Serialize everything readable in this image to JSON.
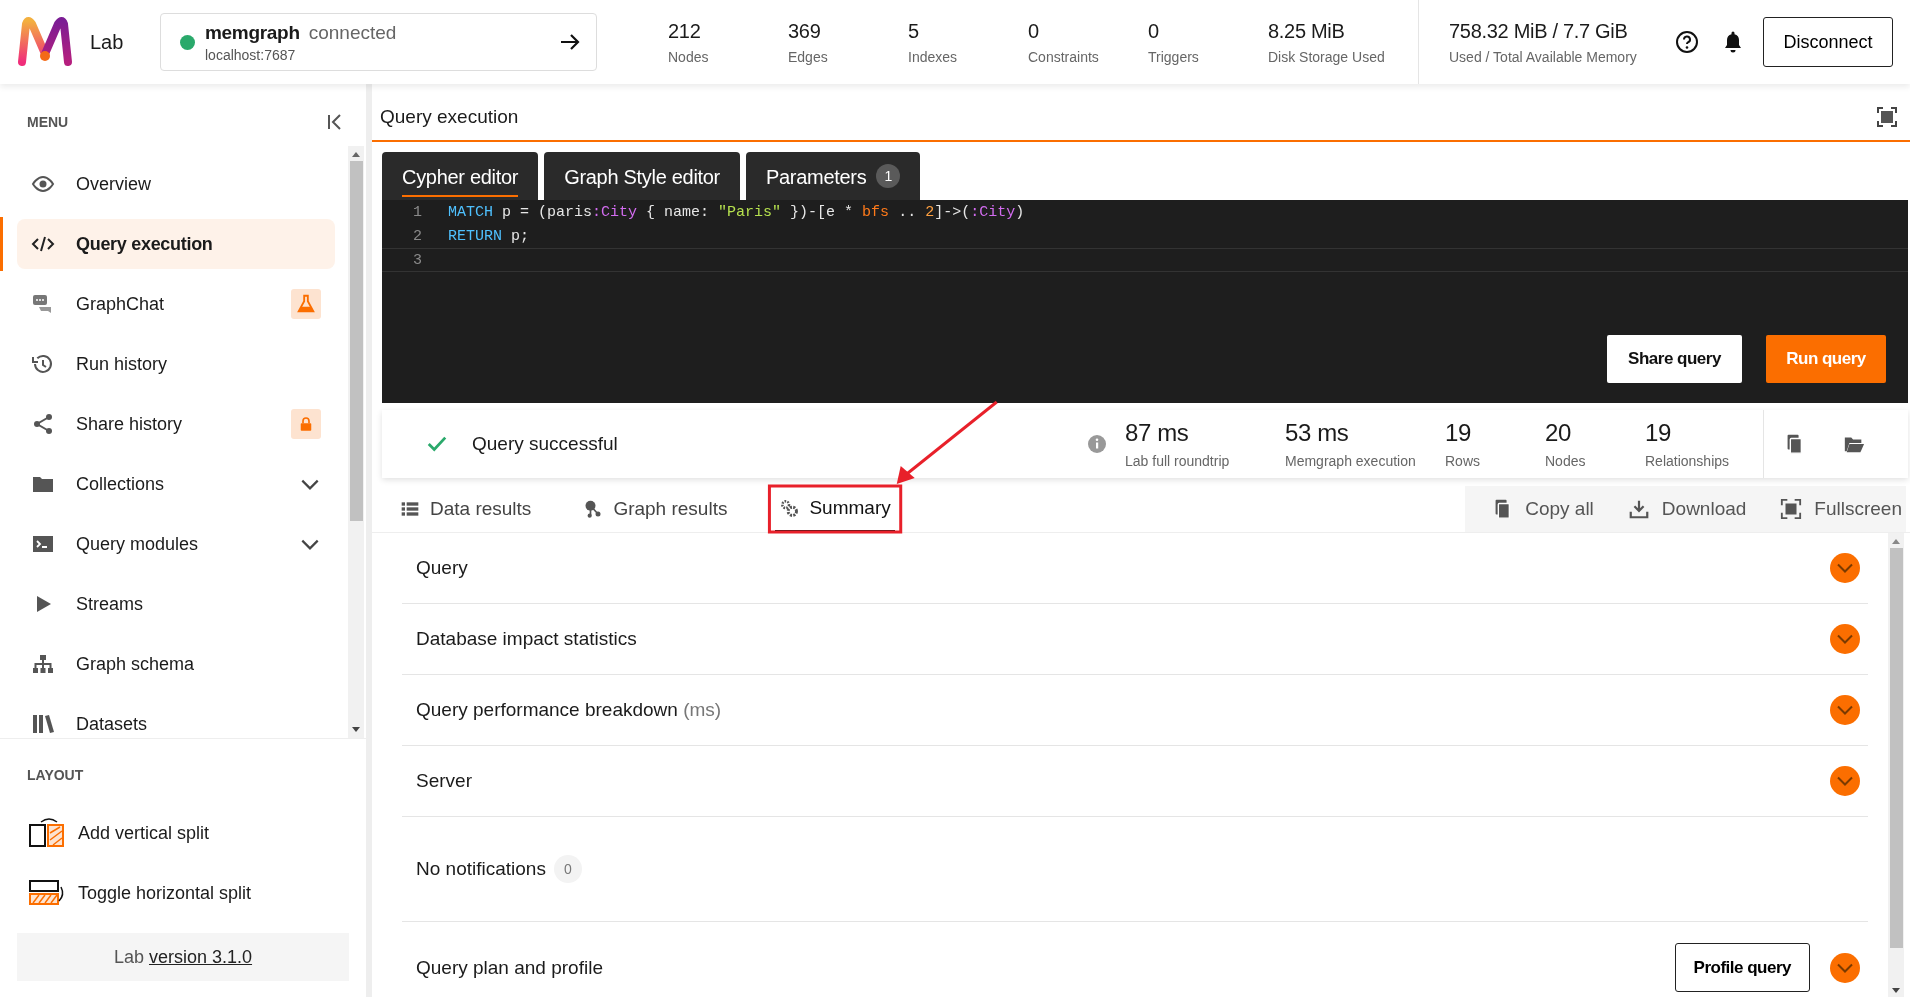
{
  "app": {
    "name": "Lab"
  },
  "connection": {
    "name": "memgraph",
    "status": "connected",
    "host": "localhost:7687",
    "online": true
  },
  "stats": [
    {
      "value": "212",
      "label": "Nodes"
    },
    {
      "value": "369",
      "label": "Edges"
    },
    {
      "value": "5",
      "label": "Indexes"
    },
    {
      "value": "0",
      "label": "Constraints"
    },
    {
      "value": "0",
      "label": "Triggers"
    },
    {
      "value": "8.25 MiB",
      "label": "Disk Storage Used"
    }
  ],
  "memory": {
    "value": "758.32 MiB / 7.7 GiB",
    "label": "Used / Total Available Memory"
  },
  "disconnect_button": "Disconnect",
  "sidebar": {
    "menu_heading": "MENU",
    "items": [
      {
        "label": "Overview",
        "selected": false,
        "experimental": false,
        "locked": false,
        "expandable": false
      },
      {
        "label": "Query execution",
        "selected": true,
        "experimental": false,
        "locked": false,
        "expandable": false
      },
      {
        "label": "GraphChat",
        "selected": false,
        "experimental": true,
        "locked": false,
        "expandable": false
      },
      {
        "label": "Run history",
        "selected": false,
        "experimental": false,
        "locked": false,
        "expandable": false
      },
      {
        "label": "Share history",
        "selected": false,
        "experimental": false,
        "locked": true,
        "expandable": false
      },
      {
        "label": "Collections",
        "selected": false,
        "experimental": false,
        "locked": false,
        "expandable": true
      },
      {
        "label": "Query modules",
        "selected": false,
        "experimental": false,
        "locked": false,
        "expandable": true
      },
      {
        "label": "Streams",
        "selected": false,
        "experimental": false,
        "locked": false,
        "expandable": false
      },
      {
        "label": "Graph schema",
        "selected": false,
        "experimental": false,
        "locked": false,
        "expandable": false
      },
      {
        "label": "Datasets",
        "selected": false,
        "experimental": false,
        "locked": false,
        "expandable": false
      }
    ],
    "layout_heading": "LAYOUT",
    "layout_items": [
      "Add vertical split",
      "Toggle horizontal split"
    ],
    "version": {
      "prefix": "Lab",
      "link": "version 3.1.0"
    }
  },
  "panel_title": "Query execution",
  "editor_tabs": [
    {
      "label": "Cypher editor",
      "selected": true
    },
    {
      "label": "Graph Style editor",
      "selected": false
    },
    {
      "label": "Parameters",
      "selected": false,
      "count": "1"
    }
  ],
  "code_lines": [
    {
      "number": "1",
      "tokens": [
        {
          "text": "MATCH",
          "kind": "keyword"
        },
        {
          "text": " p = (paris",
          "kind": "plain"
        },
        {
          "text": ":City",
          "kind": "label"
        },
        {
          "text": " { name: ",
          "kind": "plain"
        },
        {
          "text": "\"Paris\"",
          "kind": "string"
        },
        {
          "text": " })-[e * ",
          "kind": "plain"
        },
        {
          "text": "bfs",
          "kind": "function"
        },
        {
          "text": " .. ",
          "kind": "plain"
        },
        {
          "text": "2",
          "kind": "number"
        },
        {
          "text": "]->(",
          "kind": "plain"
        },
        {
          "text": ":City",
          "kind": "label"
        },
        {
          "text": ")",
          "kind": "plain"
        }
      ]
    },
    {
      "number": "2",
      "tokens": [
        {
          "text": "RETURN",
          "kind": "keyword"
        },
        {
          "text": " p;",
          "kind": "plain"
        }
      ]
    },
    {
      "number": "3"
    }
  ],
  "editor_buttons": {
    "share": "Share query",
    "run": "Run query"
  },
  "result_status": {
    "message": "Query successful",
    "success": true
  },
  "metrics": [
    {
      "value": "87 ms",
      "label": "Lab full roundtrip"
    },
    {
      "value": "53 ms",
      "label": "Memgraph execution"
    },
    {
      "value": "19",
      "label": "Rows"
    },
    {
      "value": "20",
      "label": "Nodes"
    },
    {
      "value": "19",
      "label": "Relationships"
    }
  ],
  "result_tabs": [
    {
      "label": "Data results",
      "selected": false
    },
    {
      "label": "Graph results",
      "selected": false
    },
    {
      "label": "Summary",
      "selected": true
    }
  ],
  "result_actions": [
    "Copy all",
    "Download",
    "Fullscreen"
  ],
  "summary_sections": [
    {
      "title": "Query",
      "expandable": true
    },
    {
      "title": "Database impact statistics",
      "expandable": true
    },
    {
      "title": "Query performance breakdown",
      "unit": "(ms)",
      "expandable": true
    },
    {
      "title": "Server",
      "expandable": true
    },
    {
      "title": "No notifications",
      "count": "0",
      "expandable": false
    },
    {
      "title": "Query plan and profile",
      "button": "Profile query",
      "expandable": true
    }
  ]
}
